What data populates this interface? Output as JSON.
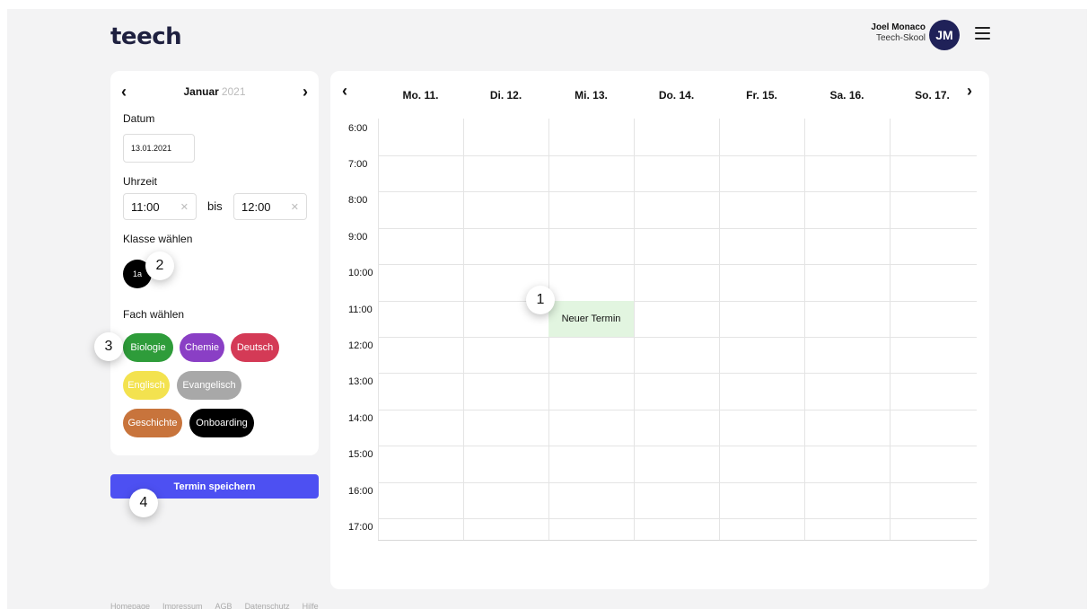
{
  "header": {
    "logo": "teech",
    "user_name": "Joel Monaco",
    "user_org": "Teech-Skool",
    "avatar_initials": "JM"
  },
  "form": {
    "month": "Januar",
    "year": "2021",
    "datum_label": "Datum",
    "datum_value": "13.01.2021",
    "uhrzeit_label": "Uhrzeit",
    "time_from": "11:00",
    "time_to": "12:00",
    "bis_label": "bis",
    "klasse_label": "Klasse wählen",
    "klasse_value": "1a",
    "fach_label": "Fach wählen",
    "subjects": [
      {
        "label": "Biologie",
        "color": "#2e9c3a"
      },
      {
        "label": "Chemie",
        "color": "#8a3fc5"
      },
      {
        "label": "Deutsch",
        "color": "#d43a56"
      },
      {
        "label": "Englisch",
        "color": "#f3e24f"
      },
      {
        "label": "Evangelisch",
        "color": "#a8a8a8"
      },
      {
        "label": "Geschichte",
        "color": "#c8743c"
      },
      {
        "label": "Onboarding",
        "color": "#000000"
      }
    ],
    "save_label": "Termin speichern"
  },
  "calendar": {
    "days": [
      "Mo. 11.",
      "Di. 12.",
      "Mi. 13.",
      "Do. 14.",
      "Fr. 15.",
      "Sa. 16.",
      "So. 17."
    ],
    "times": [
      "6:00",
      "7:00",
      "8:00",
      "9:00",
      "10:00",
      "11:00",
      "12:00",
      "13:00",
      "14:00",
      "15:00",
      "16:00",
      "17:00"
    ],
    "event_label": "Neuer Termin"
  },
  "markers": [
    "1",
    "2",
    "3",
    "4"
  ],
  "footer": [
    "Homepage",
    "Impressum",
    "AGB",
    "Datenschutz",
    "Hilfe"
  ]
}
